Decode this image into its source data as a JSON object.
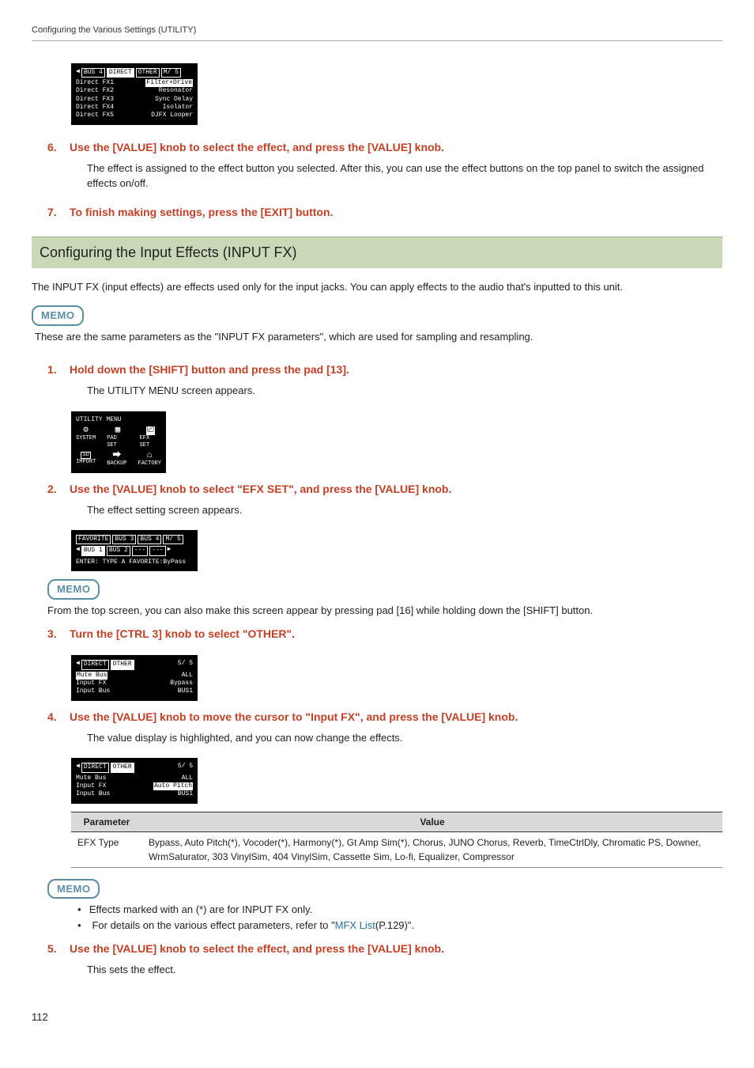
{
  "header": {
    "running": "Configuring the Various Settings (UTILITY)"
  },
  "lcd_top": {
    "tabs": [
      "BUS 4",
      "DIRECT",
      "OTHER",
      "M/ 5"
    ],
    "tabs_inv": [
      false,
      true,
      false,
      false
    ],
    "rows": [
      {
        "l": "Direct FX1",
        "r": "Filter+Drive",
        "hl": true
      },
      {
        "l": "Direct FX2",
        "r": "Resonator"
      },
      {
        "l": "Direct FX3",
        "r": "Sync Delay"
      },
      {
        "l": "Direct FX4",
        "r": "Isolator"
      },
      {
        "l": "Direct FX5",
        "r": "DJFX Looper"
      }
    ]
  },
  "steps_a": [
    {
      "num": "6.",
      "title": "Use the [VALUE] knob to select the effect, and press the [VALUE] knob.",
      "body": "The effect is assigned to the effect button you selected. After this, you can use the effect buttons on the top panel to switch the assigned effects on/off."
    },
    {
      "num": "7.",
      "title": "To finish making settings, press the [EXIT] button.",
      "body": ""
    }
  ],
  "section": {
    "title": "Configuring the Input Effects (INPUT FX)"
  },
  "intro": "The INPUT FX (input effects) are effects used only for the input jacks. You can apply effects to the audio that's inputted to this unit.",
  "memo1": {
    "label": "MEMO",
    "text": "These are the same parameters as the \"INPUT FX parameters\", which are used for sampling and resampling."
  },
  "step1": {
    "num": "1.",
    "title": "Hold down the [SHIFT] button and press the pad [13].",
    "body": "The UTILITY MENU screen appears."
  },
  "lcd_util": {
    "title": "UTILITY MENU",
    "icons_top": [
      {
        "g": "⚙",
        "t": "SYSTEM"
      },
      {
        "g": "▦",
        "t": "PAD SET"
      },
      {
        "g": "⎚",
        "t": "EFX SET",
        "sel": true
      }
    ],
    "icons_bot": [
      {
        "g": "SD",
        "t": "IMPORT"
      },
      {
        "g": "⮕",
        "t": "BACKUP"
      },
      {
        "g": "⌂",
        "t": "FACTORY"
      }
    ]
  },
  "step2": {
    "num": "2.",
    "title": "Use the [VALUE] knob to select \"EFX SET\", and press the [VALUE] knob.",
    "body": "The effect setting screen appears."
  },
  "lcd_efx": {
    "tabs": [
      "FAVORITE",
      "BUS 3",
      "BUS 4",
      "M/ 5"
    ],
    "btabs": [
      "BUS 1",
      "BUS 2",
      "---",
      "---"
    ],
    "bottom": "ENTER: TYPE A  FAVORITE:ByPass"
  },
  "memo2": {
    "label": "MEMO",
    "text": "From the top screen, you can also make this screen appear by pressing pad [16] while holding down the [SHIFT] button."
  },
  "step3": {
    "num": "3.",
    "title": "Turn the [CTRL 3] knob to select \"OTHER\"."
  },
  "lcd_other1": {
    "tabs": [
      "DIRECT",
      "OTHER"
    ],
    "page": "5/ 5",
    "rows": [
      {
        "l": "Mute Bus",
        "r": "ALL",
        "hl": true
      },
      {
        "l": "Input FX",
        "r": "Bypass"
      },
      {
        "l": "Input Bus",
        "r": "BUS1"
      }
    ]
  },
  "step4": {
    "num": "4.",
    "title": "Use the [VALUE] knob to move the cursor to \"Input FX\", and press the [VALUE] knob.",
    "body": "The value display is highlighted, and you can now change the effects."
  },
  "lcd_other2": {
    "tabs": [
      "DIRECT",
      "OTHER"
    ],
    "page": "5/ 5",
    "rows": [
      {
        "l": "Mute Bus",
        "r": "ALL"
      },
      {
        "l": "Input FX",
        "r": "Auto Pitch",
        "hl": true
      },
      {
        "l": "Input Bus",
        "r": "BUS1"
      }
    ]
  },
  "table": {
    "head": {
      "p": "Parameter",
      "v": "Value"
    },
    "row": {
      "p": "EFX Type",
      "v": "Bypass, Auto Pitch(*), Vocoder(*), Harmony(*), Gt Amp Sim(*), Chorus, JUNO Chorus, Reverb, TimeCtrlDly, Chromatic PS, Downer, WrmSaturator, 303 VinylSim, 404 VinylSim, Cassette Sim, Lo-fi, Equalizer, Compressor"
    }
  },
  "memo3": {
    "label": "MEMO",
    "b1": "Effects marked with an (*) are for INPUT FX only.",
    "b2_pre": "For details on the various effect parameters, refer to \"",
    "b2_link": "MFX List",
    "b2_post": "(P.129)\"."
  },
  "step5": {
    "num": "5.",
    "title": "Use the [VALUE] knob to select the effect, and press the [VALUE] knob.",
    "body": "This sets the effect."
  },
  "page": "112"
}
